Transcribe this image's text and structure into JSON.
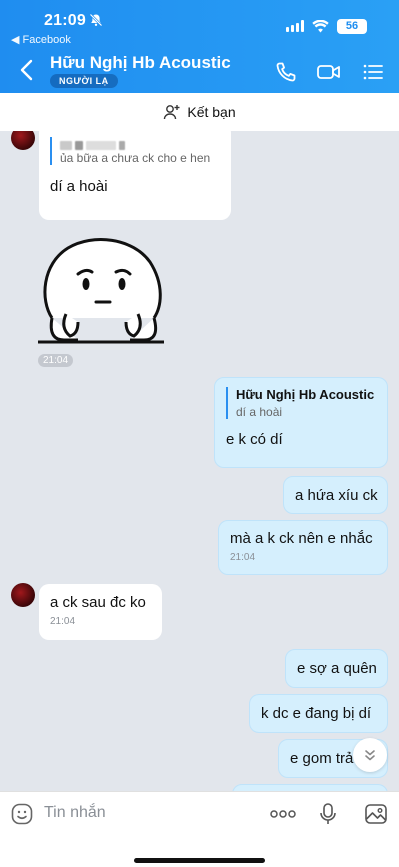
{
  "status_bar": {
    "time": "21:09",
    "back_app": "◀ Facebook",
    "battery": "56"
  },
  "header": {
    "contact_name": "Hữu Nghị Hb Acoustic",
    "badge": "NGƯỜI LẠ"
  },
  "friend_bar": {
    "label": "Kết bạn"
  },
  "messages": [
    {
      "side": "in",
      "quote_text": "ủa bữa a chưa ck cho e hen",
      "text": "dí a hoài"
    },
    {
      "side": "in",
      "type": "sticker",
      "time": "21:04"
    },
    {
      "side": "out",
      "quote_title": "Hữu Nghị Hb Acoustic",
      "quote_text": "dí a hoài",
      "text": "e k có dí"
    },
    {
      "side": "out",
      "text": "a hứa xíu ck"
    },
    {
      "side": "out",
      "text": "mà a k ck nên e nhắc",
      "time": "21:04"
    },
    {
      "side": "in",
      "text": "a ck sau đc ko",
      "time": "21:04"
    },
    {
      "side": "out",
      "text": "e sợ a quên"
    },
    {
      "side": "out",
      "text": "k dc e đang bị dí"
    },
    {
      "side": "out",
      "text": "e gom trả"
    }
  ],
  "composer": {
    "placeholder": "Tin nhắn"
  },
  "colors": {
    "header_blue": "#1f8df0",
    "outgoing_bubble": "#d5effd",
    "incoming_bubble": "#ffffff"
  }
}
